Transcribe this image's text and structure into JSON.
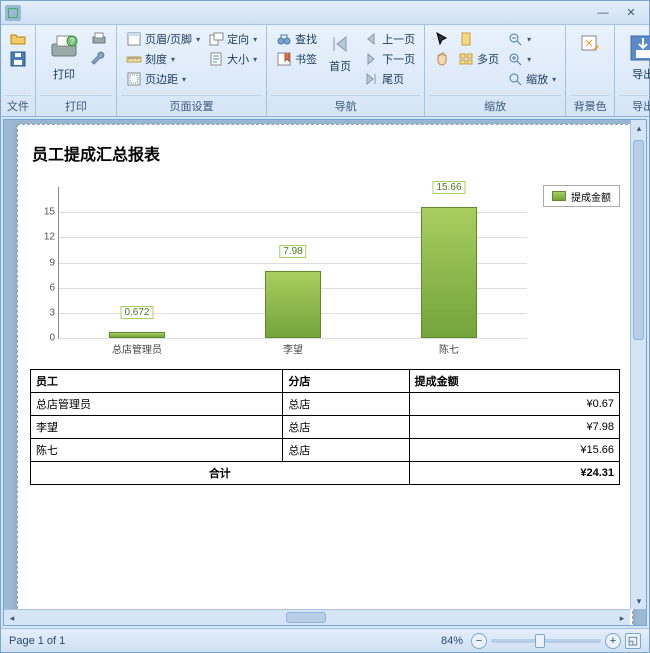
{
  "window": {
    "minimize": "—",
    "close": "✕"
  },
  "ribbon": {
    "file": {
      "label": "文件"
    },
    "print": {
      "label": "打印",
      "print_btn": "打印"
    },
    "page_setup": {
      "label": "页面设置",
      "header_footer": "页眉/页脚",
      "scale": "刻度",
      "margins": "页边距",
      "orientation": "定向",
      "size": "大小"
    },
    "nav": {
      "label": "导航",
      "find": "查找",
      "bookmarks": "书签",
      "first": "首页",
      "prev": "上一页",
      "next": "下一页",
      "last": "尾页"
    },
    "zoom": {
      "label": "缩放",
      "many": "多页",
      "zoom": "缩放"
    },
    "bg": {
      "label": "背景色"
    },
    "export": {
      "label": "导出",
      "btn": "导出"
    }
  },
  "report_title": "员工提成汇总报表",
  "legend": {
    "label": "提成金额"
  },
  "table": {
    "headers": {
      "emp": "员工",
      "branch": "分店",
      "amount": "提成金额"
    },
    "rows": [
      {
        "emp": "总店管理员",
        "branch": "总店",
        "amount": "¥0.67"
      },
      {
        "emp": "李望",
        "branch": "总店",
        "amount": "¥7.98"
      },
      {
        "emp": "陈七",
        "branch": "总店",
        "amount": "¥15.66"
      }
    ],
    "total": {
      "label": "合计",
      "amount": "¥24.31"
    }
  },
  "status": {
    "page": "Page 1 of 1",
    "zoom": "84%"
  },
  "chart_data": {
    "type": "bar",
    "title": "员工提成汇总报表",
    "categories": [
      "总店管理员",
      "李望",
      "陈七"
    ],
    "series": [
      {
        "name": "提成金额",
        "values": [
          0.672,
          7.98,
          15.66
        ]
      }
    ],
    "value_labels": [
      "0.672",
      "7.98",
      "15.66"
    ],
    "ylim": [
      0,
      18
    ],
    "yticks": [
      0,
      3,
      6,
      9,
      12,
      15
    ],
    "xlabel": "",
    "ylabel": ""
  }
}
